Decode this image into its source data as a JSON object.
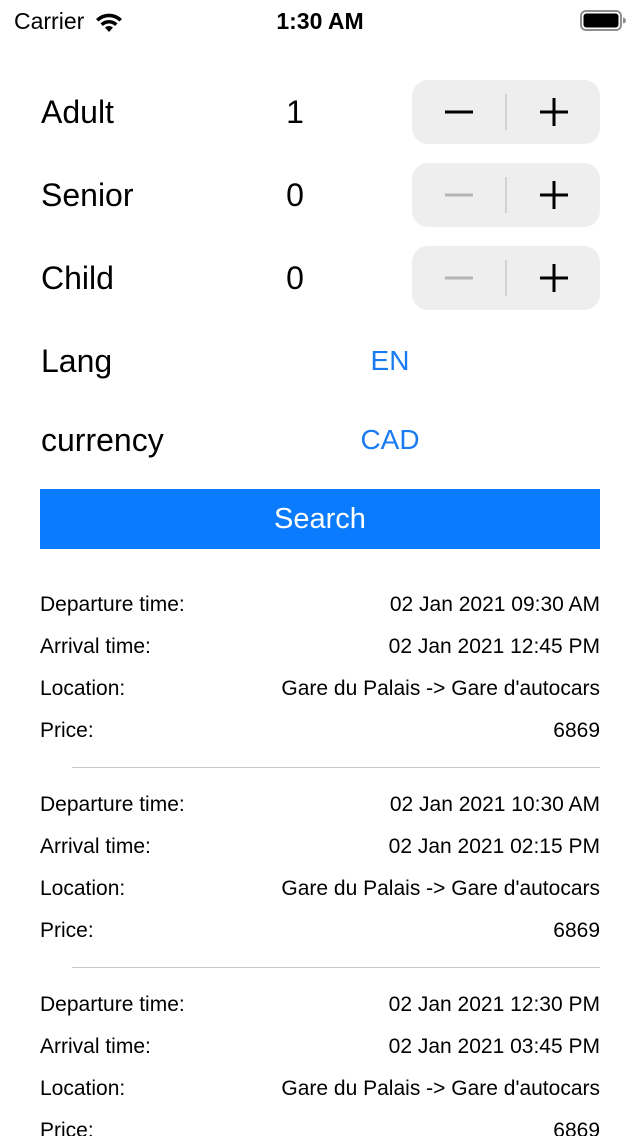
{
  "status_bar": {
    "carrier": "Carrier",
    "time": "1:30 AM"
  },
  "counters": [
    {
      "label": "Adult",
      "value": "1",
      "minus_enabled": true
    },
    {
      "label": "Senior",
      "value": "0",
      "minus_enabled": false
    },
    {
      "label": "Child",
      "value": "0",
      "minus_enabled": false
    }
  ],
  "lang": {
    "label": "Lang",
    "value": "EN"
  },
  "currency": {
    "label": "currency",
    "value": "CAD"
  },
  "search_label": "Search",
  "result_labels": {
    "departure": "Departure time:",
    "arrival": "Arrival time:",
    "location": "Location:",
    "price": "Price:"
  },
  "results": [
    {
      "departure": "02 Jan 2021 09:30 AM",
      "arrival": "02 Jan 2021 12:45 PM",
      "location": "Gare du Palais -> Gare d'autocars",
      "price": "6869"
    },
    {
      "departure": "02 Jan 2021 10:30 AM",
      "arrival": "02 Jan 2021 02:15 PM",
      "location": "Gare du Palais -> Gare d'autocars",
      "price": "6869"
    },
    {
      "departure": "02 Jan 2021 12:30 PM",
      "arrival": "02 Jan 2021 03:45 PM",
      "location": "Gare du Palais -> Gare d'autocars",
      "price": "6869"
    }
  ],
  "colors": {
    "accent": "#1a7cf2",
    "search_bg": "#0b7bfe",
    "stepper_bg": "#eeeeef",
    "disabled_glyph": "#b5b5b8",
    "divider": "#c8c8cc"
  },
  "icons": {
    "wifi": "wifi-icon",
    "battery": "battery-icon",
    "minus": "minus-icon",
    "plus": "plus-icon"
  }
}
